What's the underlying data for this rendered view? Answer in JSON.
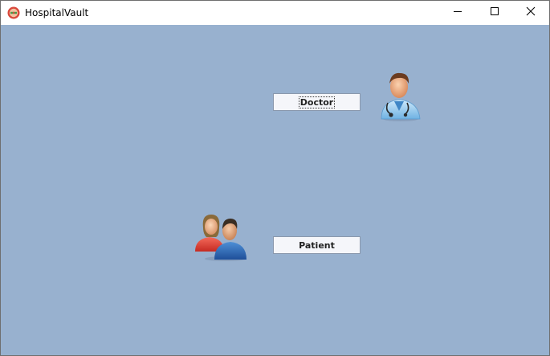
{
  "window": {
    "title": "HospitalVault",
    "controls": {
      "minimize": "minimize-icon",
      "maximize": "maximize-icon",
      "close": "close-icon"
    }
  },
  "roles": {
    "doctor": {
      "label": "Doctor",
      "icon": "doctor-icon"
    },
    "patient": {
      "label": "Patient",
      "icon": "patients-icon"
    }
  },
  "colors": {
    "background": "#98b1cf",
    "titlebar": "#ffffff",
    "button_face": "#f5f6fa"
  }
}
